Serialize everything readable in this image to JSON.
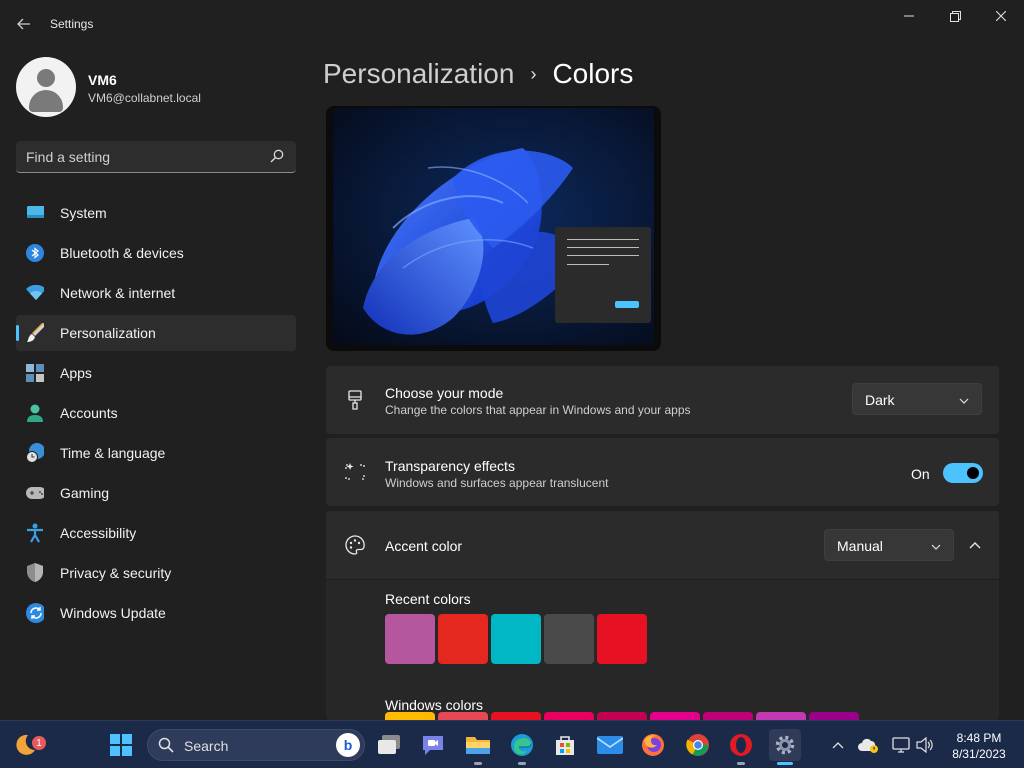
{
  "window": {
    "title": "Settings",
    "controls": {
      "minimize": "—",
      "maximize": "❐",
      "close": "✕"
    }
  },
  "user": {
    "name": "VM6",
    "email": "VM6@collabnet.local"
  },
  "search": {
    "placeholder": "Find a setting"
  },
  "sidebar": {
    "items": [
      {
        "label": "System",
        "icon": "system-icon",
        "active": false
      },
      {
        "label": "Bluetooth & devices",
        "icon": "bluetooth-icon",
        "active": false
      },
      {
        "label": "Network & internet",
        "icon": "wifi-icon",
        "active": false
      },
      {
        "label": "Personalization",
        "icon": "brush-icon",
        "active": true
      },
      {
        "label": "Apps",
        "icon": "apps-icon",
        "active": false
      },
      {
        "label": "Accounts",
        "icon": "person-icon",
        "active": false
      },
      {
        "label": "Time & language",
        "icon": "globe-clock-icon",
        "active": false
      },
      {
        "label": "Gaming",
        "icon": "gamepad-icon",
        "active": false
      },
      {
        "label": "Accessibility",
        "icon": "accessibility-icon",
        "active": false
      },
      {
        "label": "Privacy & security",
        "icon": "shield-icon",
        "active": false
      },
      {
        "label": "Windows Update",
        "icon": "update-icon",
        "active": false
      }
    ]
  },
  "breadcrumb": {
    "parent": "Personalization",
    "separator": "›",
    "current": "Colors"
  },
  "mode": {
    "title": "Choose your mode",
    "description": "Change the colors that appear in Windows and your apps",
    "value": "Dark"
  },
  "transparency": {
    "title": "Transparency effects",
    "description": "Windows and surfaces appear translucent",
    "state_label": "On",
    "on": true
  },
  "accent": {
    "title": "Accent color",
    "value": "Manual",
    "recent_label": "Recent colors",
    "recent_colors": [
      "#b4579f",
      "#e5281f",
      "#00b7c3",
      "#4a4a4a",
      "#e81123"
    ],
    "windows_label": "Windows colors",
    "windows_colors": [
      "#ffb900",
      "#e74856",
      "#e81123",
      "#ea005e",
      "#c30052",
      "#e3008c",
      "#bf0077",
      "#c239b3",
      "#9a0089"
    ]
  },
  "taskbar": {
    "search_label": "Search",
    "notification_count": "1",
    "time": "8:48 PM",
    "date": "8/31/2023"
  },
  "colors": {
    "accent": "#4cc2ff",
    "background": "#202020",
    "card": "#2b2b2b"
  }
}
